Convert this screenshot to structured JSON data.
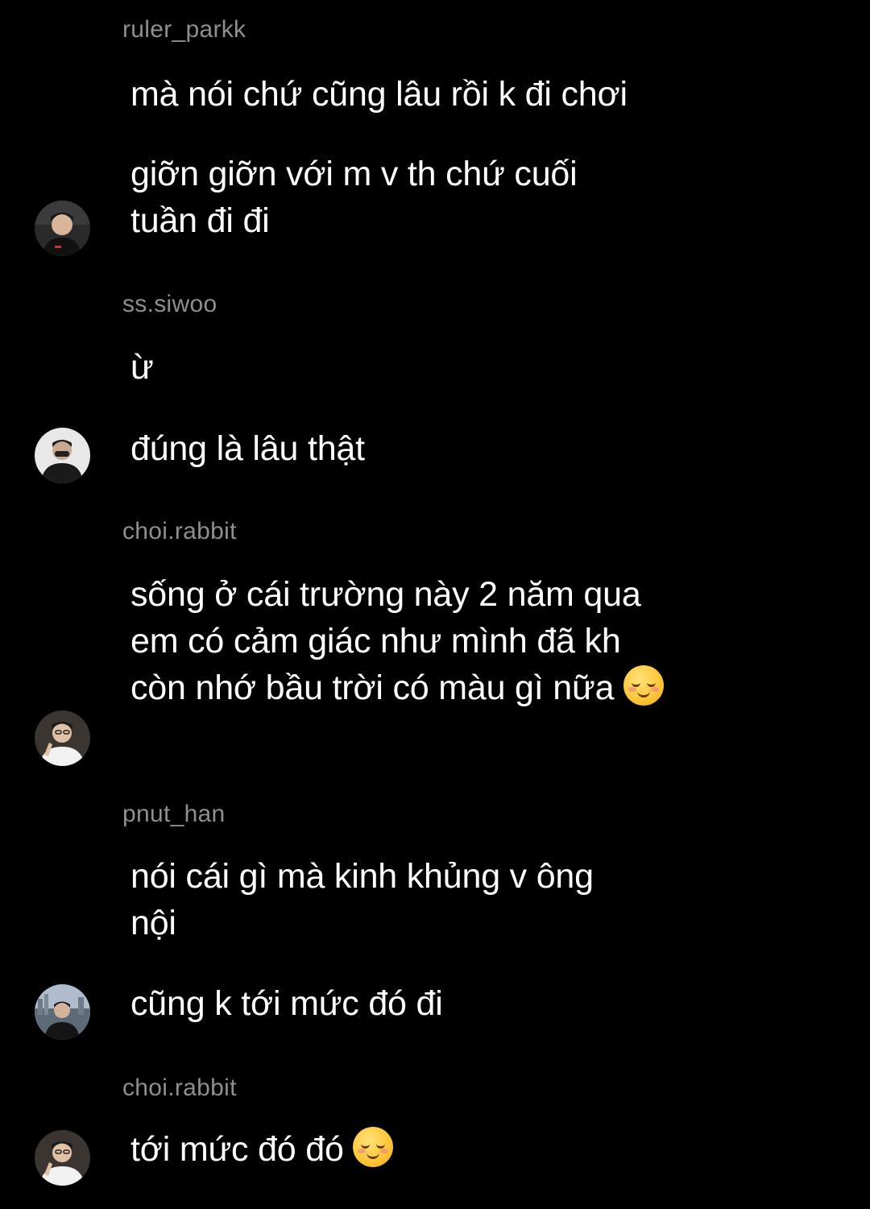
{
  "groups": [
    {
      "username": "ruler_parkk",
      "messages": [
        "mà nói chứ cũng lâu rồi k đi chơi",
        "giỡn giỡn với m v th chứ cuối tuần đi đi"
      ]
    },
    {
      "username": "ss.siwoo",
      "messages": [
        "ừ",
        "đúng là lâu thật"
      ]
    },
    {
      "username": "choi.rabbit",
      "messages": [
        "sống ở cái trường này 2 năm qua em có cảm giác như mình đã kh còn nhớ bầu trời có màu gì nữa"
      ],
      "emoji": "smiling-face-emoji"
    },
    {
      "username": "pnut_han",
      "messages": [
        "nói cái gì mà kinh khủng v ông nội",
        "cũng k tới mức đó đi"
      ]
    },
    {
      "username": "choi.rabbit",
      "messages": [
        "tới mức đó đó"
      ],
      "emoji": "smiling-face-emoji"
    }
  ],
  "colors": {
    "background": "#000000",
    "text": "#ffffff",
    "username": "#8e8e93"
  }
}
